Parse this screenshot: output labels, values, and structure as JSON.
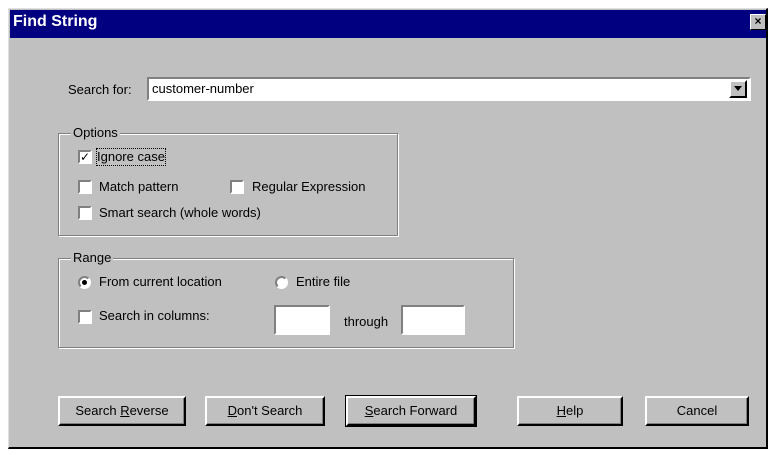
{
  "window": {
    "title": "Find String",
    "close_glyph": "×"
  },
  "search": {
    "label": "Search for:",
    "value": "customer-number"
  },
  "options": {
    "legend": "Options",
    "ignore_case": {
      "label": "Ignore case",
      "checked": true
    },
    "match_pattern": {
      "label": "Match pattern",
      "checked": false
    },
    "regular_expression": {
      "label": "Regular Expression",
      "checked": false
    },
    "smart_search": {
      "label": "Smart search (whole words)",
      "checked": false
    }
  },
  "range": {
    "legend": "Range",
    "from_current": {
      "label": "From current location",
      "selected": true
    },
    "entire_file": {
      "label": "Entire file",
      "selected": false
    },
    "search_in_columns": {
      "label": "Search in columns:",
      "checked": false
    },
    "through_label": "through",
    "from_column": "",
    "to_column": ""
  },
  "buttons": {
    "search_reverse": {
      "pre": "Search ",
      "mn": "R",
      "post": "everse"
    },
    "dont_search": {
      "pre": "",
      "mn": "D",
      "post": "on't Search"
    },
    "search_forward": {
      "pre": "",
      "mn": "S",
      "post": "earch Forward"
    },
    "help": {
      "pre": "",
      "mn": "H",
      "post": "elp"
    },
    "cancel": {
      "pre": "Cancel",
      "mn": "",
      "post": ""
    }
  },
  "icons": {
    "check": "✓",
    "dropdown": "triangle-down"
  }
}
